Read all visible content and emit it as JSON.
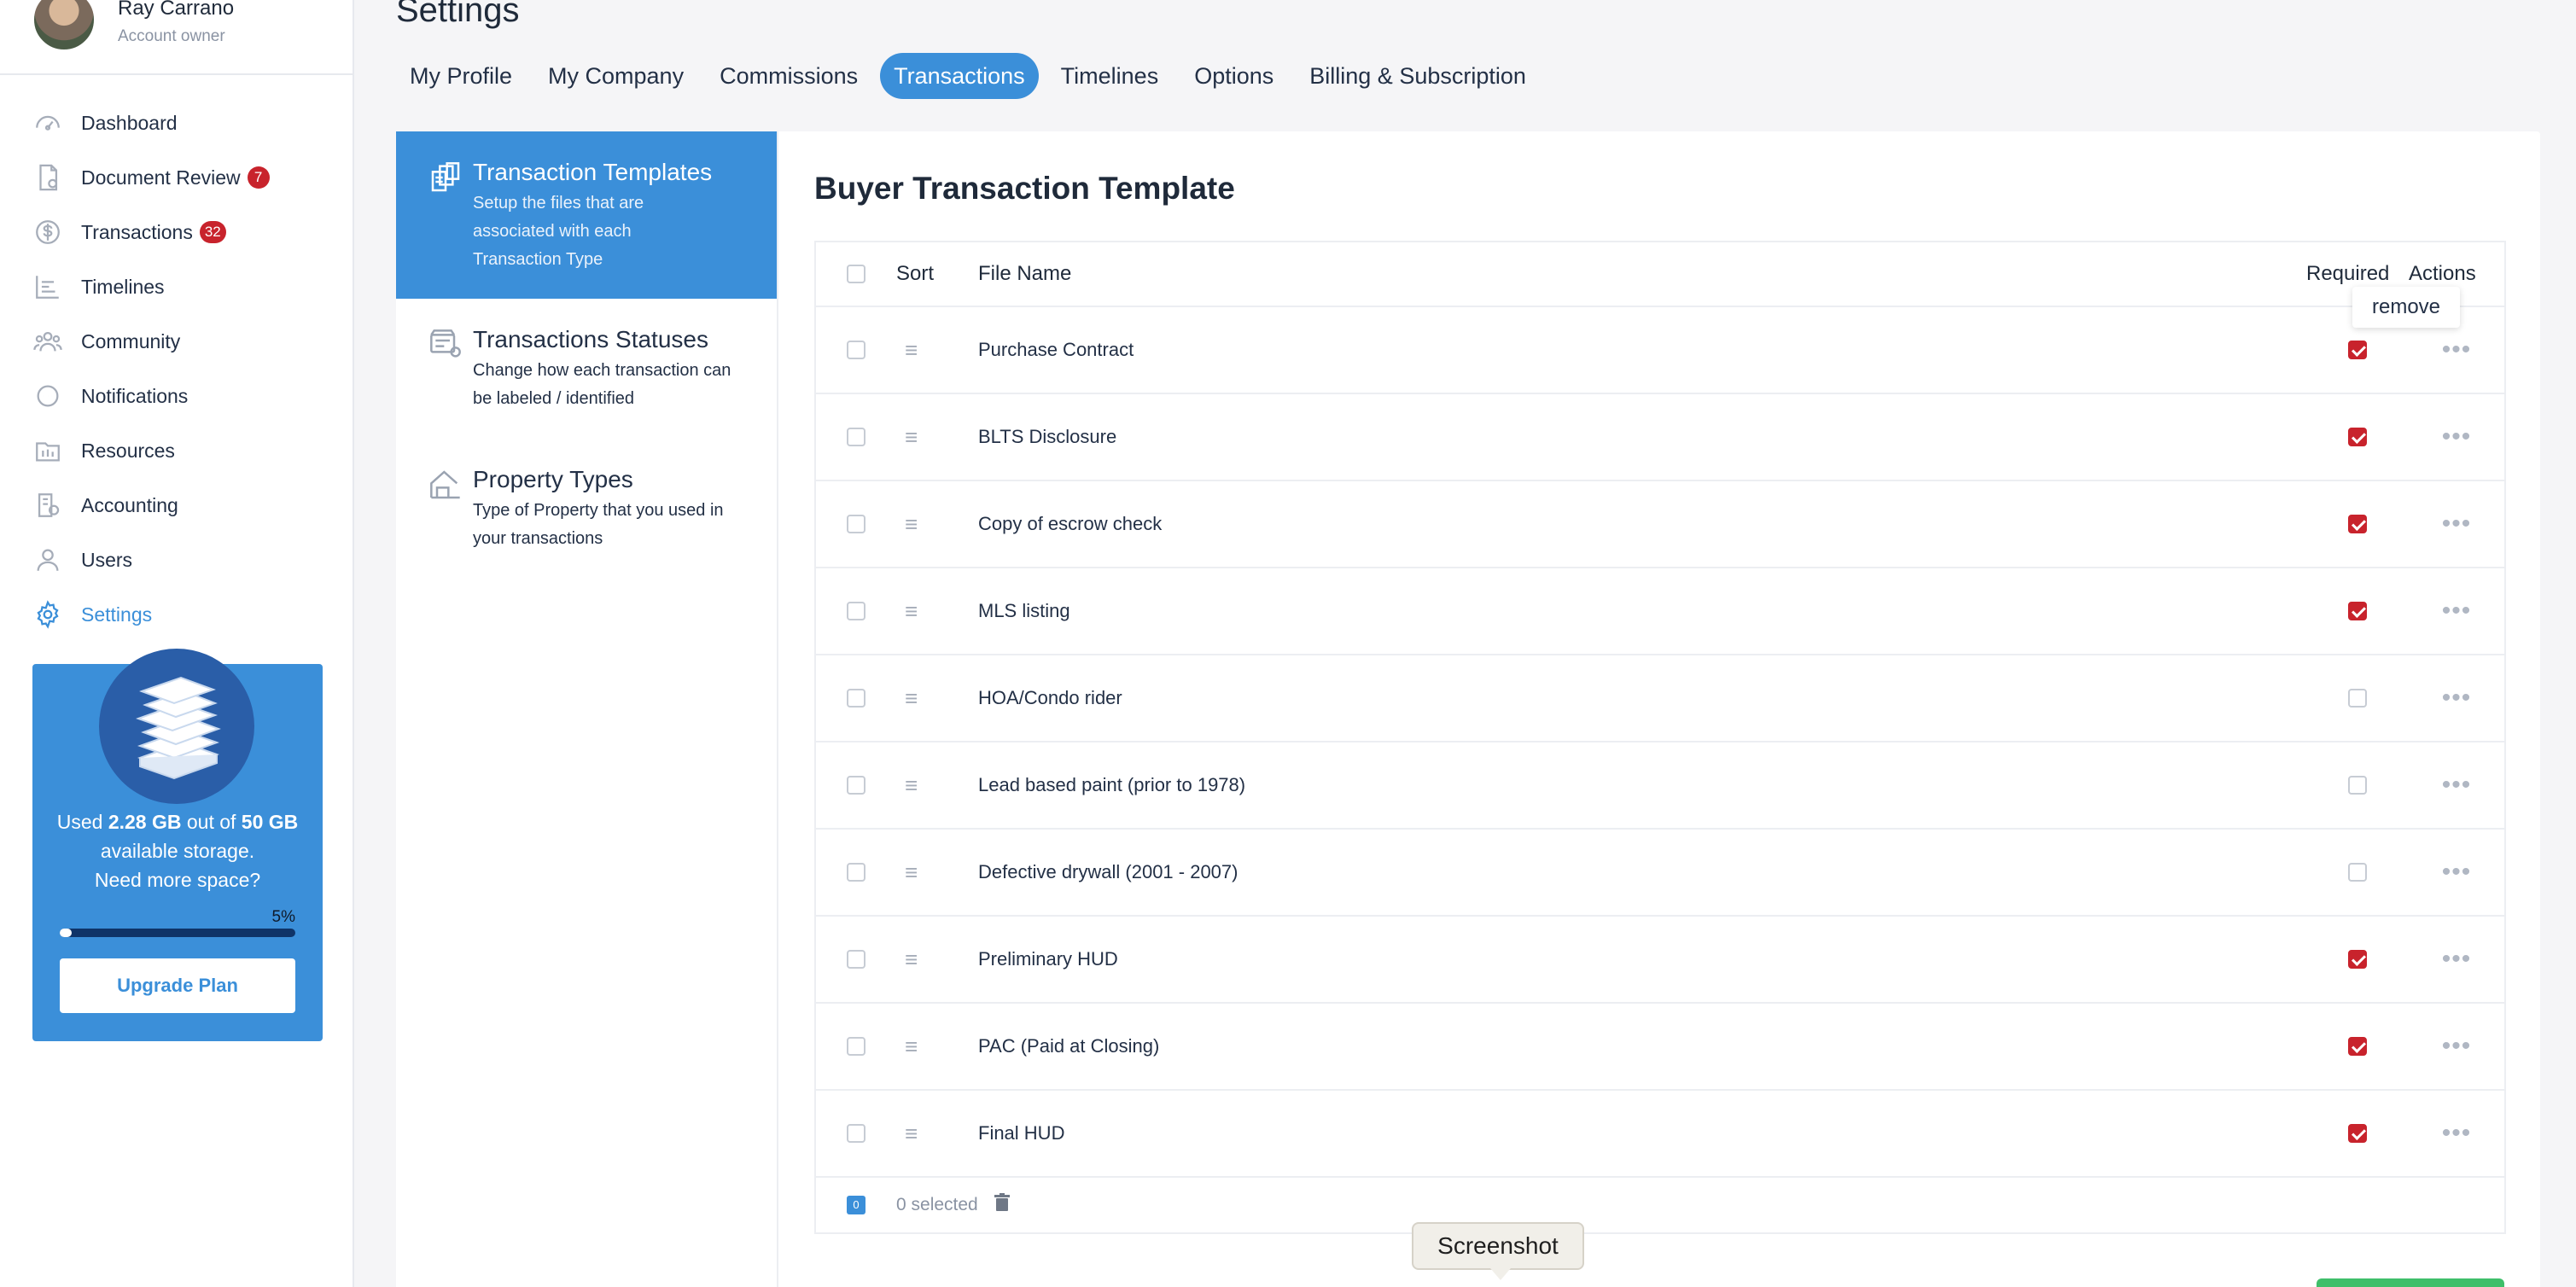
{
  "profile": {
    "name": "Ray Carrano",
    "role": "Account owner"
  },
  "nav": [
    {
      "label": "Dashboard",
      "icon": "dashboard-icon"
    },
    {
      "label": "Document Review",
      "icon": "document-review-icon",
      "badge": "7"
    },
    {
      "label": "Transactions",
      "icon": "dollar-icon",
      "badge": "32"
    },
    {
      "label": "Timelines",
      "icon": "timeline-icon"
    },
    {
      "label": "Community",
      "icon": "community-icon"
    },
    {
      "label": "Notifications",
      "icon": "chat-bubble-icon"
    },
    {
      "label": "Resources",
      "icon": "folder-icon"
    },
    {
      "label": "Accounting",
      "icon": "accounting-icon"
    },
    {
      "label": "Users",
      "icon": "user-icon"
    },
    {
      "label": "Settings",
      "icon": "gear-icon",
      "active": true
    }
  ],
  "storage": {
    "used_prefix": "Used ",
    "used": "2.28 GB",
    "mid": " out of ",
    "total": "50 GB",
    "suffix": " available storage.",
    "question": "Need more space?",
    "percent_label": "5%",
    "percent": 5,
    "button": "Upgrade Plan"
  },
  "page": {
    "title": "Settings",
    "tabs": [
      "My Profile",
      "My Company",
      "Commissions",
      "Transactions",
      "Timelines",
      "Options",
      "Billing & Subscription"
    ],
    "active_tab": "Transactions"
  },
  "left_menu": [
    {
      "title": "Transaction Templates",
      "desc": "Setup the files that are associated with each Transaction Type",
      "active": true,
      "icon": "templates-icon"
    },
    {
      "title": "Transactions Statuses",
      "desc": "Change how each transaction can be labeled / identified",
      "icon": "status-settings-icon"
    },
    {
      "title": "Property Types",
      "desc": "Type of Property that you used in your transactions",
      "icon": "house-icon"
    }
  ],
  "content": {
    "title": "Buyer Transaction Template",
    "headers": {
      "sort": "Sort",
      "file_name": "File Name",
      "required": "Required",
      "actions": "Actions"
    },
    "rows": [
      {
        "name": "Purchase Contract",
        "required": true
      },
      {
        "name": "BLTS Disclosure",
        "required": true
      },
      {
        "name": "Copy of escrow check",
        "required": true
      },
      {
        "name": "MLS listing",
        "required": true
      },
      {
        "name": "HOA/Condo rider",
        "required": false
      },
      {
        "name": "Lead based paint (prior to 1978)",
        "required": false
      },
      {
        "name": "Defective drywall (2001 - 2007)",
        "required": false
      },
      {
        "name": "Preliminary HUD",
        "required": true
      },
      {
        "name": "PAC (Paid at Closing)",
        "required": true
      },
      {
        "name": "Final HUD",
        "required": true
      }
    ],
    "selected_count": "0",
    "selected_label": "0 selected",
    "remove_label": "remove"
  },
  "tooltip": "Screenshot",
  "colors": {
    "accent": "#3b8fd9",
    "badge": "#c8232c",
    "check": "#c8232c"
  }
}
